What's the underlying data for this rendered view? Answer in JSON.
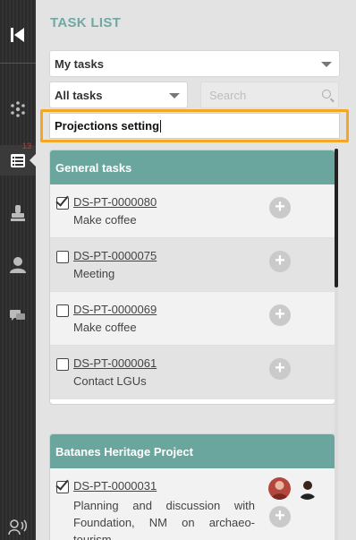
{
  "sidebar": {
    "items": [
      {
        "name": "collapse",
        "icon": "collapse-left-icon"
      },
      {
        "name": "network",
        "icon": "network-icon"
      },
      {
        "name": "tasks",
        "icon": "task-list-icon",
        "badge": "13"
      },
      {
        "name": "stamp",
        "icon": "stamp-icon"
      },
      {
        "name": "user",
        "icon": "user-icon"
      },
      {
        "name": "chat",
        "icon": "chat-icon"
      },
      {
        "name": "voice",
        "icon": "voice-user-icon"
      }
    ]
  },
  "header": {
    "title": "TASK LIST"
  },
  "filters": {
    "owner_select": "My tasks",
    "status_select": "All tasks",
    "search_placeholder": "Search",
    "project_input": "Projections setting"
  },
  "groups": [
    {
      "title": "General tasks",
      "tasks": [
        {
          "id": "DS-PT-0000080",
          "name": "Make coffee",
          "checked": true
        },
        {
          "id": "DS-PT-0000075",
          "name": "Meeting",
          "checked": false
        },
        {
          "id": "DS-PT-0000069",
          "name": "Make coffee",
          "checked": false
        },
        {
          "id": "DS-PT-0000061",
          "name": "Contact LGUs",
          "checked": false
        }
      ]
    },
    {
      "title": "Batanes Heritage Project",
      "tasks": [
        {
          "id": "DS-PT-0000031",
          "name": "Planning and discussion with Foundation, NM on archaeo-tourism",
          "checked": true
        }
      ]
    }
  ],
  "colors": {
    "accent": "#6ba69e",
    "highlight": "#f5a623",
    "badge": "#e03030"
  }
}
